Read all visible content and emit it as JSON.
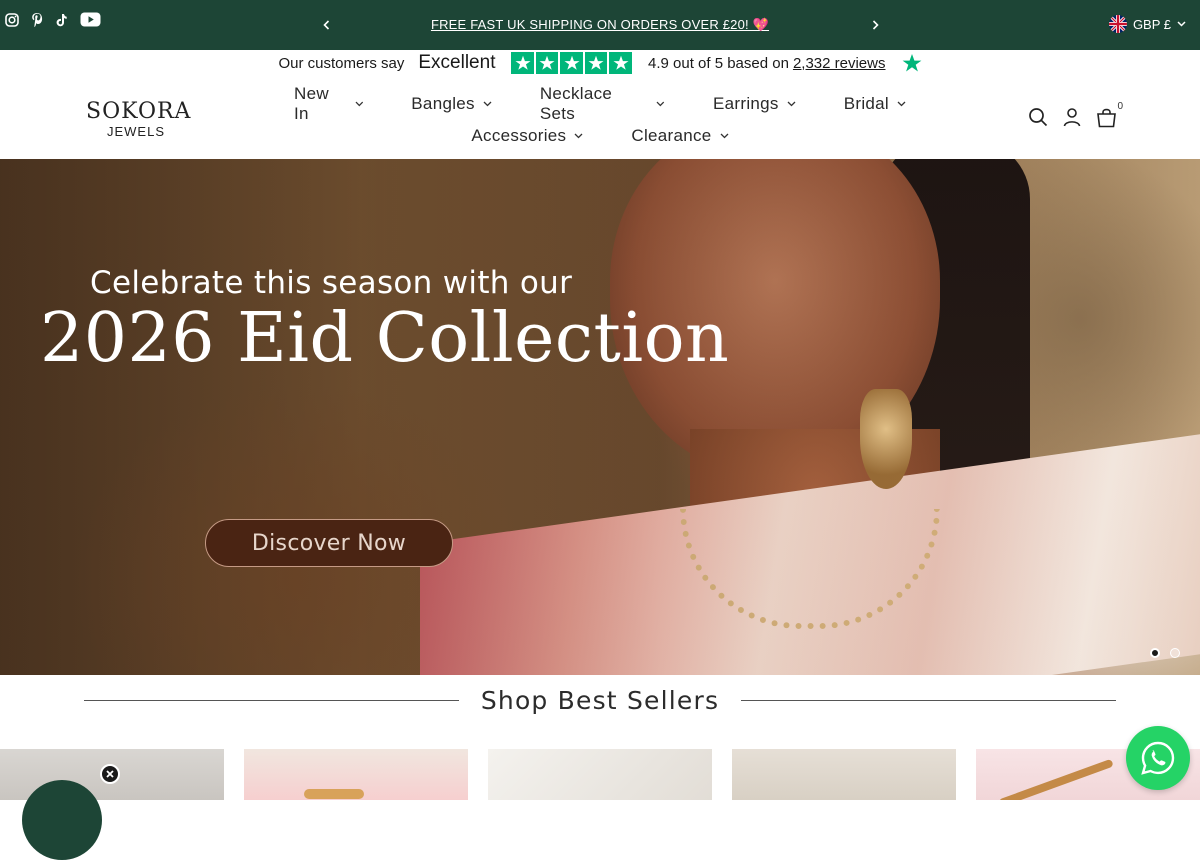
{
  "colors": {
    "announcement_bg": "#1d4536",
    "trustpilot_green": "#00b67a",
    "hero_button_bg": "#4a2413",
    "whatsapp_green": "#25d366"
  },
  "announcement": {
    "social_icons": [
      "instagram-icon",
      "pinterest-icon",
      "tiktok-icon",
      "youtube-icon"
    ],
    "message": "FREE FAST UK SHIPPING ON ORDERS OVER £20! 💖",
    "currency": "GBP £"
  },
  "trustpilot": {
    "intro": "Our customers say",
    "rating_word": "Excellent",
    "stars": 5,
    "score_text": "4.9 out of 5 based on",
    "reviews_text": "2,332 reviews"
  },
  "header": {
    "logo_word": "SOKORA",
    "logo_sub": "JEWELS",
    "nav_row1": [
      "New In",
      "Bangles",
      "Necklace Sets",
      "Earrings",
      "Bridal"
    ],
    "nav_row2": [
      "Accessories",
      "Clearance"
    ],
    "cart_count": "0"
  },
  "hero": {
    "subtitle": "Celebrate this season with our",
    "title": "2026 Eid Collection",
    "button": "Discover Now",
    "slides": 2,
    "active_slide": 1
  },
  "best_sellers": {
    "title": "Shop Best Sellers"
  }
}
